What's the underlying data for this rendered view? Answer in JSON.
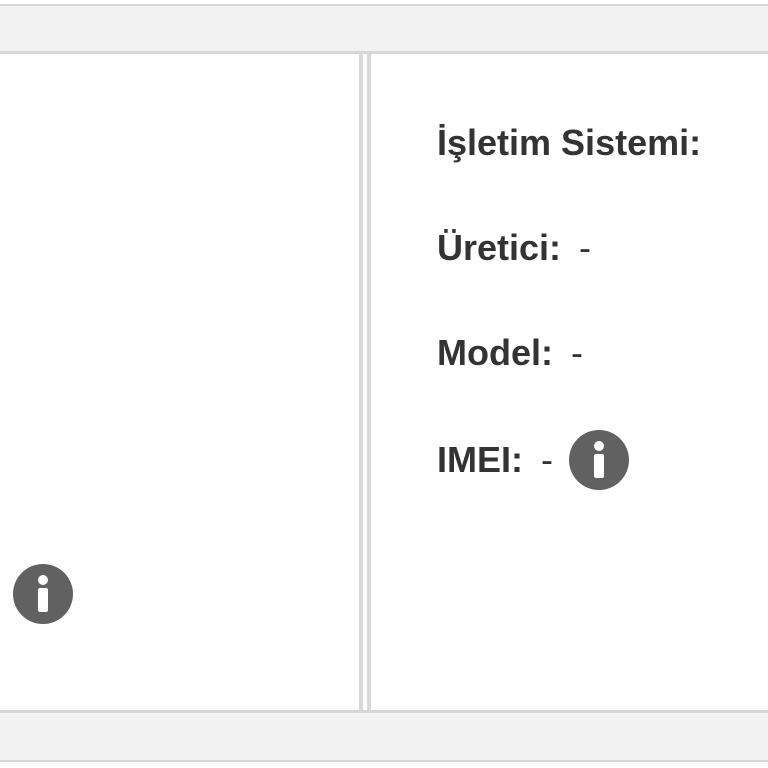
{
  "device_info": {
    "os": {
      "label": "İşletim Sistemi:",
      "value": ""
    },
    "manufacturer": {
      "label": "Üretici:",
      "value": "-"
    },
    "model": {
      "label": "Model:",
      "value": "-"
    },
    "imei": {
      "label": "IMEI:",
      "value": "-"
    }
  },
  "icons": {
    "imei_info": "info-icon",
    "left_panel_info": "info-icon"
  },
  "colors": {
    "text": "#333333",
    "icon_bg": "#616161",
    "bar_bg": "#f2f2f2",
    "border": "#d6d6d6"
  }
}
